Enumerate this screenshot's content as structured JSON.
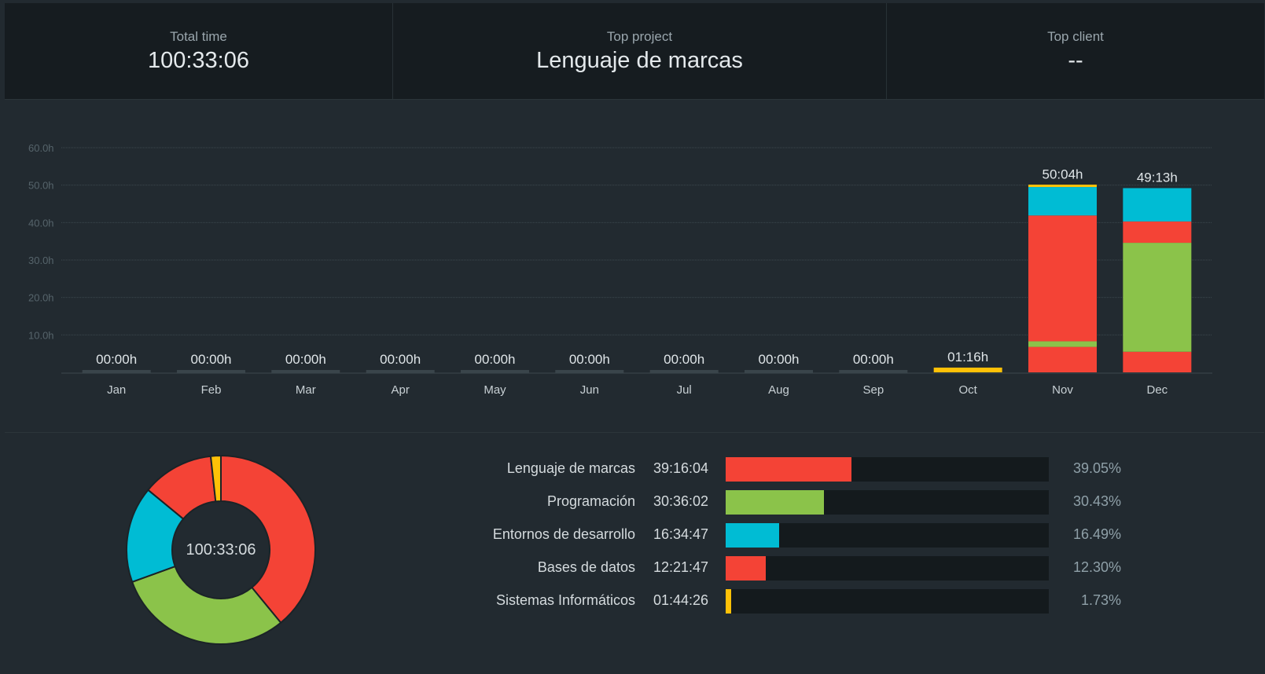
{
  "summary": {
    "total_time_label": "Total time",
    "total_time_value": "100:33:06",
    "top_project_label": "Top project",
    "top_project_value": "Lenguaje de marcas",
    "top_client_label": "Top client",
    "top_client_value": "--"
  },
  "colors": {
    "lenguaje": "#f44336",
    "programacion": "#8bc34a",
    "entornos": "#00bcd4",
    "bases": "#f44336",
    "sistemas": "#ffc107",
    "empty_bar": "#3a454b"
  },
  "chart_data": {
    "type": "bar",
    "stacked": true,
    "categories": [
      "Jan",
      "Feb",
      "Mar",
      "Apr",
      "May",
      "Jun",
      "Jul",
      "Aug",
      "Sep",
      "Oct",
      "Nov",
      "Dec"
    ],
    "yticks": [
      "10.0h",
      "20.0h",
      "30.0h",
      "40.0h",
      "50.0h",
      "60.0h"
    ],
    "ylim": [
      0,
      60
    ],
    "grid": true,
    "totals_labels": [
      "00:00h",
      "00:00h",
      "00:00h",
      "00:00h",
      "00:00h",
      "00:00h",
      "00:00h",
      "00:00h",
      "00:00h",
      "01:16h",
      "50:04h",
      "49:13h"
    ],
    "stack_order": [
      "Bases de datos",
      "Programación",
      "Lenguaje de marcas",
      "Entornos de desarrollo",
      "Sistemas Informáticos"
    ],
    "series": [
      {
        "name": "Bases de datos",
        "color": "#f44336",
        "values": [
          0,
          0,
          0,
          0,
          0,
          0,
          0,
          0,
          0,
          0,
          6.8,
          5.5
        ]
      },
      {
        "name": "Programación",
        "color": "#8bc34a",
        "values": [
          0,
          0,
          0,
          0,
          0,
          0,
          0,
          0,
          0,
          0,
          1.5,
          29.1
        ]
      },
      {
        "name": "Lenguaje de marcas",
        "color": "#f44336",
        "values": [
          0,
          0,
          0,
          0,
          0,
          0,
          0,
          0,
          0,
          0,
          33.6,
          5.7
        ]
      },
      {
        "name": "Entornos de desarrollo",
        "color": "#00bcd4",
        "values": [
          0,
          0,
          0,
          0,
          0,
          0,
          0,
          0,
          0,
          0,
          7.6,
          8.9
        ]
      },
      {
        "name": "Sistemas Informáticos",
        "color": "#ffc107",
        "values": [
          0,
          0,
          0,
          0,
          0,
          0,
          0,
          0,
          0,
          1.27,
          0.5,
          0
        ]
      }
    ]
  },
  "donut": {
    "center_label": "100:33:06",
    "slices": [
      {
        "name": "Lenguaje de marcas",
        "pct": 39.05,
        "color": "#f44336"
      },
      {
        "name": "Programación",
        "pct": 30.43,
        "color": "#8bc34a"
      },
      {
        "name": "Entornos de desarrollo",
        "pct": 16.49,
        "color": "#00bcd4"
      },
      {
        "name": "Bases de datos",
        "pct": 12.3,
        "color": "#f44336"
      },
      {
        "name": "Sistemas Informáticos",
        "pct": 1.73,
        "color": "#ffc107"
      }
    ]
  },
  "projects": [
    {
      "name": "Lenguaje de marcas",
      "time": "39:16:04",
      "pct_label": "39.05%",
      "fraction": 0.39,
      "color": "#f44336"
    },
    {
      "name": "Programación",
      "time": "30:36:02",
      "pct_label": "30.43%",
      "fraction": 0.305,
      "color": "#8bc34a"
    },
    {
      "name": "Entornos de desarrollo",
      "time": "16:34:47",
      "pct_label": "16.49%",
      "fraction": 0.165,
      "color": "#00bcd4"
    },
    {
      "name": "Bases de datos",
      "time": "12:21:47",
      "pct_label": "12.30%",
      "fraction": 0.123,
      "color": "#f44336"
    },
    {
      "name": "Sistemas Informáticos",
      "time": "01:44:26",
      "pct_label": "1.73%",
      "fraction": 0.018,
      "color": "#ffc107"
    }
  ]
}
